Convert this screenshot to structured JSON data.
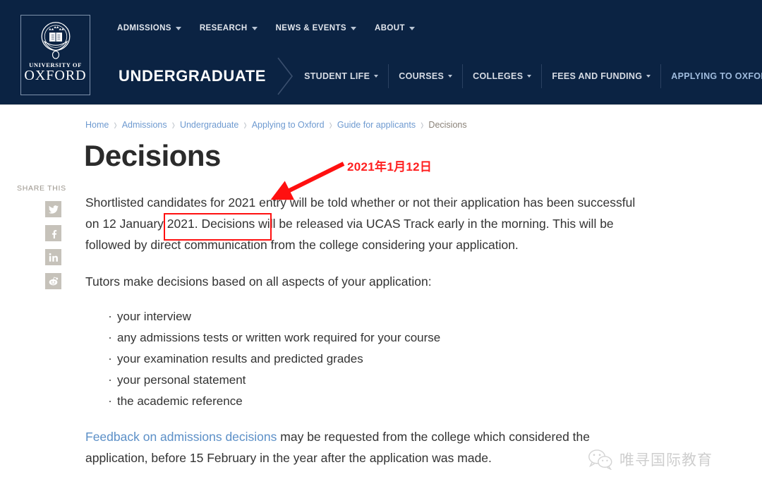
{
  "header": {
    "logo": {
      "crest_icon": "oxford-crest-icon",
      "line1": "UNIVERSITY OF",
      "line2": "OXFORD"
    },
    "top_nav": [
      {
        "label": "ADMISSIONS",
        "has_dropdown": true
      },
      {
        "label": "RESEARCH",
        "has_dropdown": true
      },
      {
        "label": "NEWS & EVENTS",
        "has_dropdown": true
      },
      {
        "label": "ABOUT",
        "has_dropdown": true
      }
    ],
    "section_title": "UNDERGRADUATE",
    "sub_nav": [
      {
        "label": "STUDENT LIFE",
        "has_dropdown": true,
        "active": false
      },
      {
        "label": "COURSES",
        "has_dropdown": true,
        "active": false
      },
      {
        "label": "COLLEGES",
        "has_dropdown": true,
        "active": false
      },
      {
        "label": "FEES AND FUNDING",
        "has_dropdown": true,
        "active": false
      },
      {
        "label": "APPLYING TO OXFORD",
        "has_dropdown": true,
        "active": true
      }
    ],
    "background_color": "#0b2343"
  },
  "breadcrumb": {
    "separator": "›",
    "items": [
      {
        "label": "Home",
        "current": false
      },
      {
        "label": "Admissions",
        "current": false
      },
      {
        "label": "Undergraduate",
        "current": false
      },
      {
        "label": "Applying to Oxford",
        "current": false
      },
      {
        "label": "Guide for applicants",
        "current": false
      },
      {
        "label": "Decisions",
        "current": true
      }
    ],
    "link_color": "#6e9ad0",
    "current_color": "#8a8278"
  },
  "page": {
    "title": "Decisions"
  },
  "share": {
    "label": "SHARE THIS",
    "icons": [
      {
        "name": "twitter-icon"
      },
      {
        "name": "facebook-icon"
      },
      {
        "name": "linkedin-icon"
      },
      {
        "name": "reddit-icon"
      }
    ],
    "tile_color": "#c6c2ba"
  },
  "content": {
    "paragraph1_part1": "Shortlisted candidates for 2021 entry will be told whether or not their application has been successful on ",
    "paragraph1_highlight": "12 January 2021.",
    "paragraph1_part2": " Decisions will be released via UCAS Track early in the morning. This will be followed by direct communication from the college considering your application.",
    "paragraph2": "Tutors make decisions based on all aspects of your application:",
    "bullets": [
      "your interview",
      "any admissions tests or written work required for your course",
      "your examination results and predicted grades",
      "your personal statement",
      "the academic reference"
    ],
    "paragraph3_link": "Feedback on admissions decisions",
    "paragraph3_rest": " may be requested from the college which considered the application, before 15 February in the year after the application was made.",
    "link_color": "#5b8fc7"
  },
  "annotations": {
    "date_note": "2021年1月12日",
    "arrow_icon": "red-arrow-icon",
    "highlight_box_icon": "red-rectangle-highlight",
    "color": "#ff1f1f"
  },
  "watermark": {
    "icon": "wechat-icon",
    "text": "唯寻国际教育"
  }
}
